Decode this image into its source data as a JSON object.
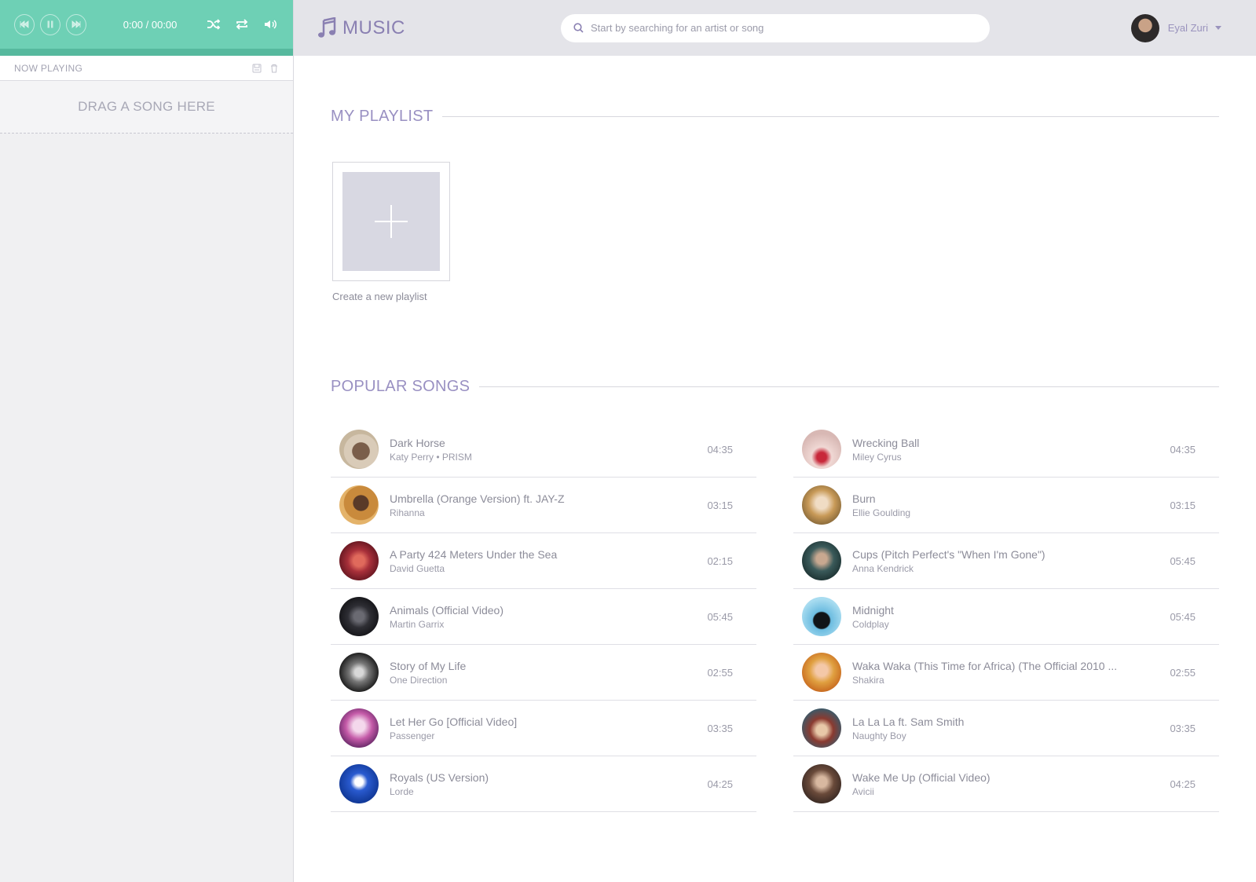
{
  "player": {
    "time": "0:00 / 00:00"
  },
  "now_playing": {
    "title": "NOW PLAYING",
    "drop_hint": "DRAG A SONG HERE"
  },
  "header": {
    "logo_text": "MUSIC",
    "search_placeholder": "Start by searching for an artist or song",
    "user_name": "Eyal Zuri"
  },
  "playlist": {
    "heading": "MY PLAYLIST",
    "create_label": "Create a new playlist"
  },
  "popular": {
    "heading": "POPULAR SONGS",
    "left": [
      {
        "title": "Dark Horse",
        "artist": "Katy Perry • PRISM",
        "duration": "04:35"
      },
      {
        "title": "Umbrella (Orange Version) ft. JAY-Z",
        "artist": "Rihanna",
        "duration": "03:15"
      },
      {
        "title": "A Party 424 Meters Under the Sea",
        "artist": "David Guetta",
        "duration": "02:15"
      },
      {
        "title": "Animals (Official Video)",
        "artist": "Martin Garrix",
        "duration": "05:45"
      },
      {
        "title": "Story of My Life",
        "artist": "One Direction",
        "duration": "02:55"
      },
      {
        "title": "Let Her Go [Official Video]",
        "artist": "Passenger",
        "duration": "03:35"
      },
      {
        "title": "Royals (US Version)",
        "artist": "Lorde",
        "duration": "04:25"
      }
    ],
    "right": [
      {
        "title": "Wrecking Ball",
        "artist": "Miley Cyrus",
        "duration": "04:35"
      },
      {
        "title": "Burn",
        "artist": "Ellie Goulding",
        "duration": "03:15"
      },
      {
        "title": "Cups (Pitch Perfect's \"When I'm Gone\")",
        "artist": "Anna Kendrick",
        "duration": "05:45"
      },
      {
        "title": "Midnight",
        "artist": "Coldplay",
        "duration": "05:45"
      },
      {
        "title": "Waka Waka (This Time for Africa) (The Official 2010 ...",
        "artist": "Shakira",
        "duration": "02:55"
      },
      {
        "title": "La La La ft. Sam Smith",
        "artist": "Naughty Boy",
        "duration": "03:35"
      },
      {
        "title": "Wake Me Up (Official Video)",
        "artist": "Avicii",
        "duration": "04:25"
      }
    ]
  },
  "colors": {
    "player_bg": "#6ed0b5",
    "accent": "#9990c2",
    "header_bg": "#e4e4e9"
  }
}
